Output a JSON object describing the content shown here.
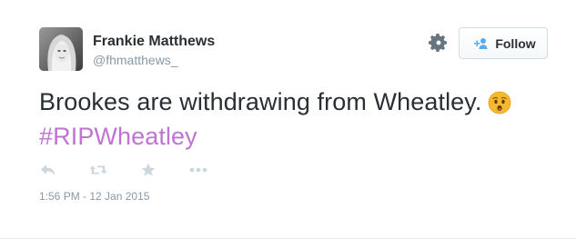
{
  "user": {
    "name": "Frankie Matthews",
    "handle": "@fhmatthews_"
  },
  "header": {
    "follow_label": "Follow"
  },
  "tweet": {
    "text": "Brookes are withdrawing from Wheatley.",
    "hashtag": "#RIPWheatley",
    "timestamp": "1:56 PM - 12 Jan 2015"
  },
  "icons": {
    "avatar": "avatar",
    "settings": "gear-icon",
    "follow": "add-user-icon",
    "emoji": "hushed-face-emoji",
    "reply": "reply-icon",
    "retweet": "retweet-icon",
    "favorite": "star-icon",
    "more": "more-icon"
  },
  "colors": {
    "hashtag": "#c073d2",
    "text": "#292f33",
    "muted": "#8899a6",
    "icon": "#ccd6dd",
    "follow_icon": "#55acee",
    "emoji": "#f5b82e"
  }
}
